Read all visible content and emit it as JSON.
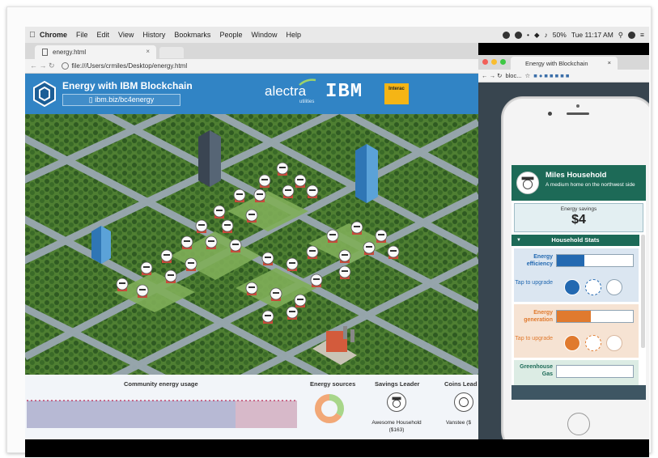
{
  "menubar": {
    "items": [
      "Chrome",
      "File",
      "Edit",
      "View",
      "History",
      "Bookmarks",
      "People",
      "Window",
      "Help"
    ],
    "battery": "50%",
    "time": "Tue 11:17 AM"
  },
  "browser": {
    "tab_title": "energy.html",
    "tab_close": "×",
    "url": "file:///Users/crmiles/Desktop/energy.html"
  },
  "app": {
    "title": "Energy with IBM Blockchain",
    "link": "ibm.biz/bc4energy",
    "sponsors": {
      "alectra": "alectra",
      "alectra_sub": "utilities",
      "ibm": "IBM",
      "interac": "Interac"
    }
  },
  "stats": {
    "usage_label": "Community energy usage",
    "sources_label": "Energy sources",
    "savings_label": "Savings Leader",
    "coins_label": "Coins Lead",
    "savings_leader_name": "Awesome Household",
    "savings_leader_amount": "($163)",
    "coins_leader_name": "Vanstee ($",
    "sources_colors": {
      "solar": "#f0b840",
      "wind": "#a8d68a",
      "grid": "#f2a877"
    }
  },
  "window2": {
    "tab_title": "Energy with Blockchain",
    "tab_close": "×",
    "url": "bloc...",
    "dot_colors": [
      "#f25f58",
      "#f9bd2f",
      "#3ec844"
    ]
  },
  "phone": {
    "household_name": "Miles Household",
    "household_desc": "A medium home on the northwest side",
    "savings_label": "Energy savings",
    "savings_value": "$4",
    "stats_header": "Household Stats",
    "rows": [
      {
        "label": "Energy efficiency",
        "level": 0.36,
        "color": "#2369b1",
        "label_color": "#2369b1"
      },
      {
        "label": "Energy generation",
        "level": 0.45,
        "color": "#e07a2e",
        "label_color": "#e07a2e"
      },
      {
        "label": "Greenhouse Gas",
        "level": 0.0,
        "color": "#1d6a57",
        "label_color": "#1d6a57"
      }
    ],
    "upgrade_labels": [
      "Tap to upgrade",
      "Tap to upgrade"
    ]
  },
  "colors": {
    "header_blue": "#3184c5",
    "phone_green": "#1d6a57"
  }
}
